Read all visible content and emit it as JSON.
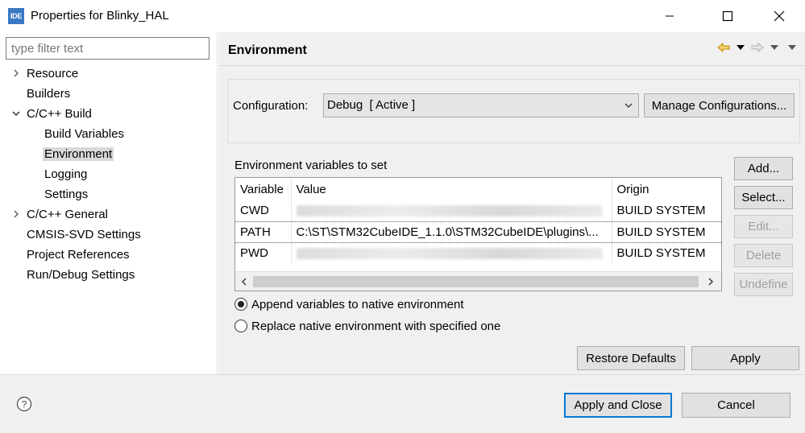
{
  "window": {
    "app_icon_text": "IDE",
    "title": "Properties for Blinky_HAL"
  },
  "sidebar": {
    "filter_placeholder": "type filter text",
    "items": [
      {
        "label": "Resource",
        "expandable": true,
        "expanded": false
      },
      {
        "label": "Builders"
      },
      {
        "label": "C/C++ Build",
        "expandable": true,
        "expanded": true
      },
      {
        "label": "Build Variables"
      },
      {
        "label": "Environment",
        "selected": true
      },
      {
        "label": "Logging"
      },
      {
        "label": "Settings"
      },
      {
        "label": "C/C++ General",
        "expandable": true,
        "expanded": false
      },
      {
        "label": "CMSIS-SVD Settings"
      },
      {
        "label": "Project References"
      },
      {
        "label": "Run/Debug Settings"
      }
    ]
  },
  "main": {
    "title": "Environment",
    "configuration": {
      "label": "Configuration:",
      "value": "Debug  [ Active ]",
      "manage_button": "Manage Configurations..."
    },
    "env_label": "Environment variables to set",
    "table": {
      "columns": [
        "Variable",
        "Value",
        "Origin"
      ],
      "rows": [
        {
          "variable": "CWD",
          "value": "",
          "value_blurred": true,
          "origin": "BUILD SYSTEM"
        },
        {
          "variable": "PATH",
          "value": "C:\\ST\\STM32CubeIDE_1.1.0\\STM32CubeIDE\\plugins\\...",
          "value_blurred": false,
          "origin": "BUILD SYSTEM",
          "selected": true
        },
        {
          "variable": "PWD",
          "value": "",
          "value_blurred": true,
          "origin": "BUILD SYSTEM"
        }
      ]
    },
    "side_buttons": {
      "add": "Add...",
      "select": "Select...",
      "edit": "Edit...",
      "delete": "Delete",
      "undefine": "Undefine"
    },
    "radio": {
      "append": "Append variables to native environment",
      "replace": "Replace native environment with specified one",
      "selected": "append"
    },
    "restore_defaults": "Restore Defaults",
    "apply": "Apply"
  },
  "footer": {
    "apply_and_close": "Apply and Close",
    "cancel": "Cancel"
  },
  "colors": {
    "accent": "#0078d7",
    "app_icon": "#3a78c3",
    "panel_bg": "#f0f0f0"
  }
}
